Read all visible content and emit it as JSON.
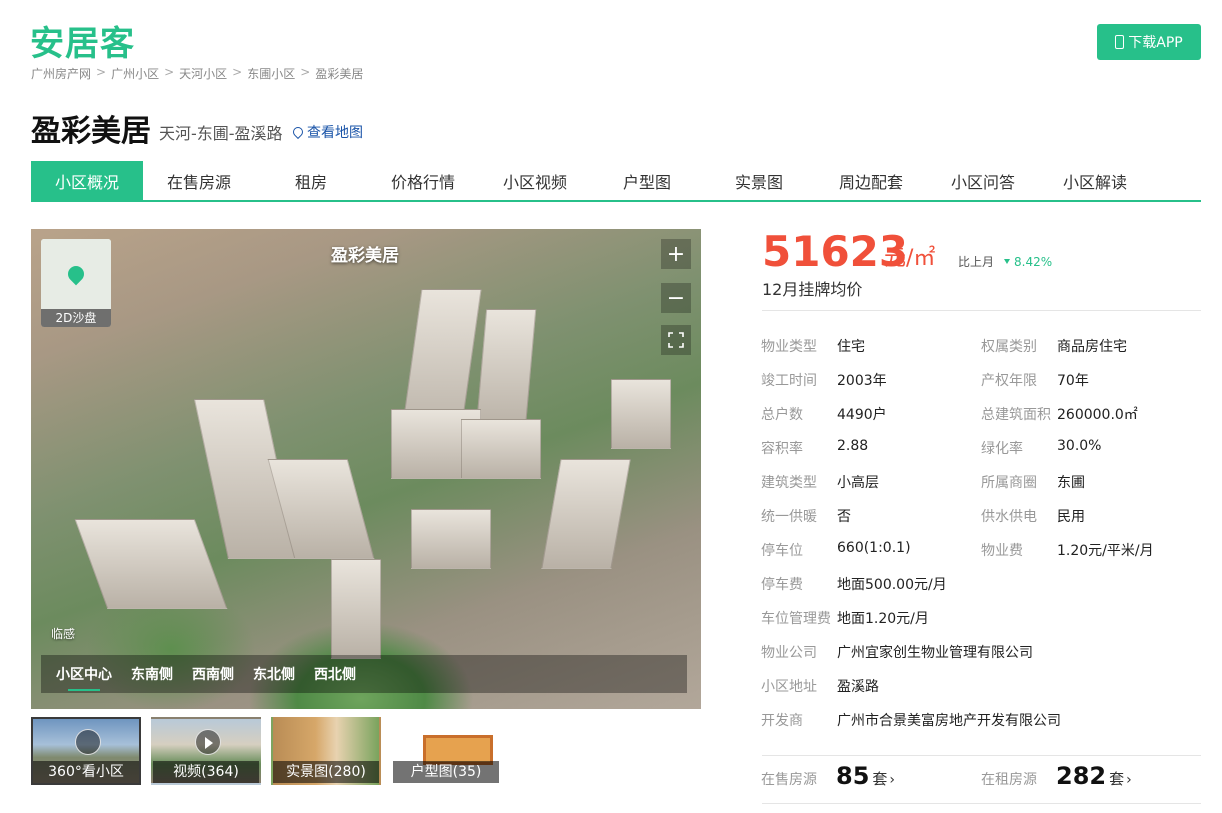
{
  "brand": {
    "logo": "安居客",
    "download_label": "下载APP"
  },
  "breadcrumb": [
    "广州房产网",
    "广州小区",
    "天河小区",
    "东圃小区",
    "盈彩美居"
  ],
  "header": {
    "title": "盈彩美居",
    "address": "天河-东圃-盈溪路",
    "map_link": "查看地图"
  },
  "tabs": [
    "小区概况",
    "在售房源",
    "租房",
    "价格行情",
    "小区视频",
    "户型图",
    "实景图",
    "周边配套",
    "小区问答",
    "小区解读"
  ],
  "pano": {
    "title": "盈彩美居",
    "sandbox_label": "2D沙盘",
    "sense_label": "临感",
    "views": [
      "小区中心",
      "东南侧",
      "西南侧",
      "东北侧",
      "西北侧"
    ],
    "zoom_in": "+",
    "zoom_out": "−"
  },
  "thumbs": [
    "360°看小区",
    "视频(364)",
    "实景图(280)",
    "户型图(35)"
  ],
  "price": {
    "value": "51623",
    "unit": "元/㎡",
    "mom_label": "比上月",
    "mom_value": "8.42%",
    "label": "12月挂牌均价"
  },
  "info": {
    "type_k": "物业类型",
    "type_v": "住宅",
    "right_k": "权属类别",
    "right_v": "商品房住宅",
    "year_k": "竣工时间",
    "year_v": "2003年",
    "term_k": "产权年限",
    "term_v": "70年",
    "households_k": "总户数",
    "households_v": "4490户",
    "area_k": "总建筑面积",
    "area_v": "260000.0㎡",
    "far_k": "容积率",
    "far_v": "2.88",
    "green_k": "绿化率",
    "green_v": "30.0%",
    "btype_k": "建筑类型",
    "btype_v": "小高层",
    "district_k": "所属商圈",
    "district_v": "东圃",
    "heat_k": "统一供暖",
    "heat_v": "否",
    "water_k": "供水供电",
    "water_v": "民用",
    "parking_k": "停车位",
    "parking_v": "660(1:0.1)",
    "fee_k": "物业费",
    "fee_v": "1.20元/平米/月",
    "pfee_k": "停车费",
    "pfee_v": "地面500.00元/月",
    "pmgmt_k": "车位管理费",
    "pmgmt_v": "地面1.20元/月",
    "company_k": "物业公司",
    "company_v": "广州宜家创生物业管理有限公司",
    "addr_k": "小区地址",
    "addr_v": "盈溪路",
    "dev_k": "开发商",
    "dev_v": "广州市合景美富房地产开发有限公司"
  },
  "stats": {
    "sale_k": "在售房源",
    "sale_n": "85",
    "sale_u": "套",
    "rent_k": "在租房源",
    "rent_n": "282",
    "rent_u": "套"
  }
}
